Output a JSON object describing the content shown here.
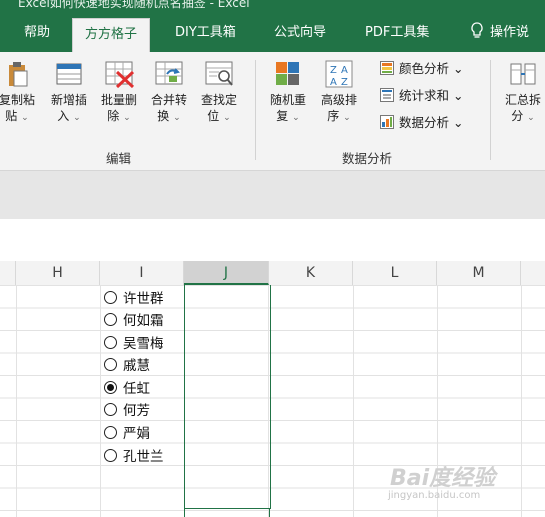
{
  "title_fragment": "Excel如何快速地实现随机点名抽签 - Excel",
  "tabs": [
    {
      "label": "帮助",
      "active": false
    },
    {
      "label": "方方格子",
      "active": true
    },
    {
      "label": "DIY工具箱",
      "active": false
    },
    {
      "label": "公式向导",
      "active": false
    },
    {
      "label": "PDF工具集",
      "active": false
    },
    {
      "label": "操作说",
      "active": false
    }
  ],
  "ribbon": {
    "edit_buttons": [
      {
        "line1": "复制粘",
        "line2": "贴"
      },
      {
        "line1": "新增插",
        "line2": "入"
      },
      {
        "line1": "批量删",
        "line2": "除"
      },
      {
        "line1": "合并转",
        "line2": "换"
      },
      {
        "line1": "查找定",
        "line2": "位"
      }
    ],
    "analysis_buttons": [
      {
        "line1": "随机重",
        "line2": "复"
      },
      {
        "line1": "高级排",
        "line2": "序"
      }
    ],
    "small_buttons": [
      {
        "label": "颜色分析"
      },
      {
        "label": "统计求和"
      },
      {
        "label": "数据分析"
      }
    ],
    "summary_button": {
      "line1": "汇总拆",
      "line2": "分"
    },
    "group_edit": "编辑",
    "group_analysis": "数据分析",
    "caret": "⌄"
  },
  "columns": [
    "H",
    "I",
    "J",
    "K",
    "L",
    "M"
  ],
  "selected_column": "J",
  "radio_options": [
    {
      "label": "许世群",
      "checked": false
    },
    {
      "label": "何如霜",
      "checked": false
    },
    {
      "label": "吴雪梅",
      "checked": false
    },
    {
      "label": "戚慧",
      "checked": false
    },
    {
      "label": "任虹",
      "checked": true
    },
    {
      "label": "何芳",
      "checked": false
    },
    {
      "label": "严娟",
      "checked": false
    },
    {
      "label": "孔世兰",
      "checked": false
    }
  ],
  "watermark": {
    "big": "Bai度经验",
    "small": "jingyan.baidu.com"
  },
  "colors": {
    "excel_green": "#217346",
    "ribbon_bg": "#f3f3f3"
  }
}
